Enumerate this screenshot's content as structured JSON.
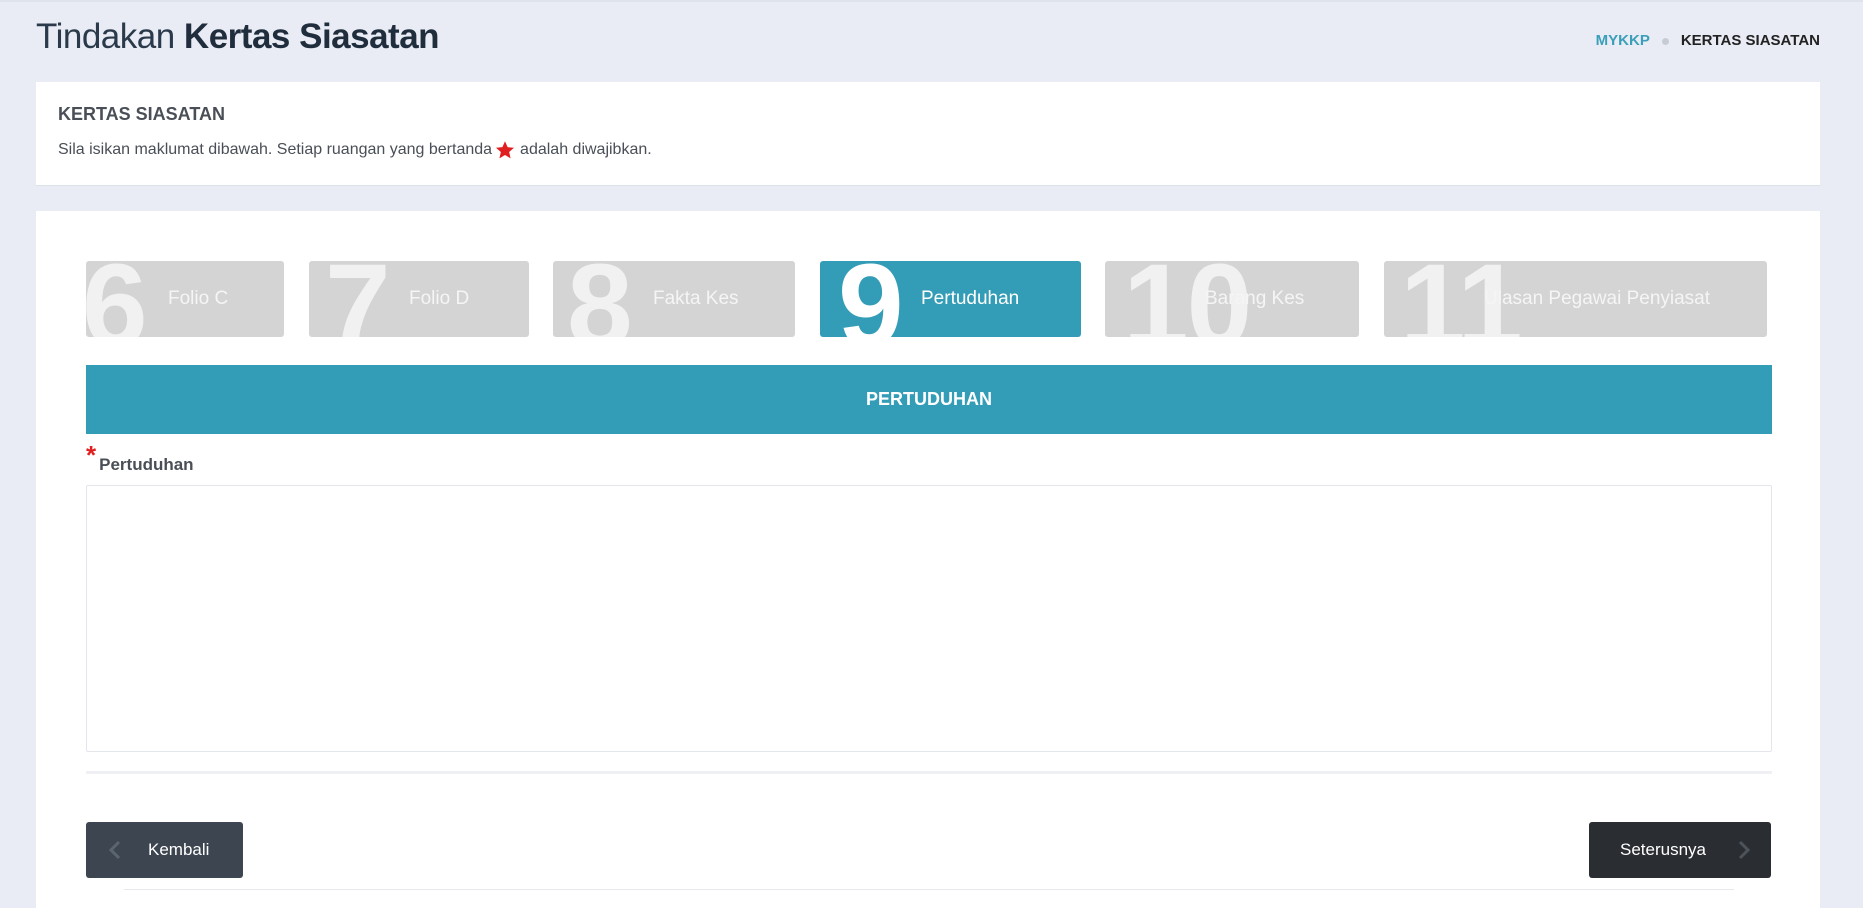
{
  "header": {
    "title_light": "Tindakan",
    "title_bold": "Kertas Siasatan",
    "breadcrumb": {
      "link": "MYKKP",
      "current": "KERTAS SIASATAN"
    }
  },
  "info": {
    "title": "KERTAS SIASATAN",
    "desc_before": "Sila isikan maklumat dibawah. Setiap ruangan yang bertanda",
    "desc_after": "adalah diwajibkan.",
    "star_color": "#e02020"
  },
  "steps": [
    {
      "num": "6",
      "label": "Folio C",
      "active": false
    },
    {
      "num": "7",
      "label": "Folio D",
      "active": false
    },
    {
      "num": "8",
      "label": "Fakta Kes",
      "active": false
    },
    {
      "num": "9",
      "label": "Pertuduhan",
      "active": true
    },
    {
      "num": "10",
      "label": "Barang Kes",
      "active": false
    },
    {
      "num": "11",
      "label": "Ulasan Pegawai Penyiasat",
      "active": false
    }
  ],
  "section": {
    "title": "PERTUDUHAN"
  },
  "form": {
    "field_label": "Pertuduhan",
    "required_mark": "*",
    "value": ""
  },
  "buttons": {
    "back": "Kembali",
    "next": "Seterusnya"
  },
  "colors": {
    "accent": "#339db7",
    "inactive_step": "#d4d4d4",
    "back_btn": "#3d4650",
    "next_btn": "#2a2e33"
  }
}
